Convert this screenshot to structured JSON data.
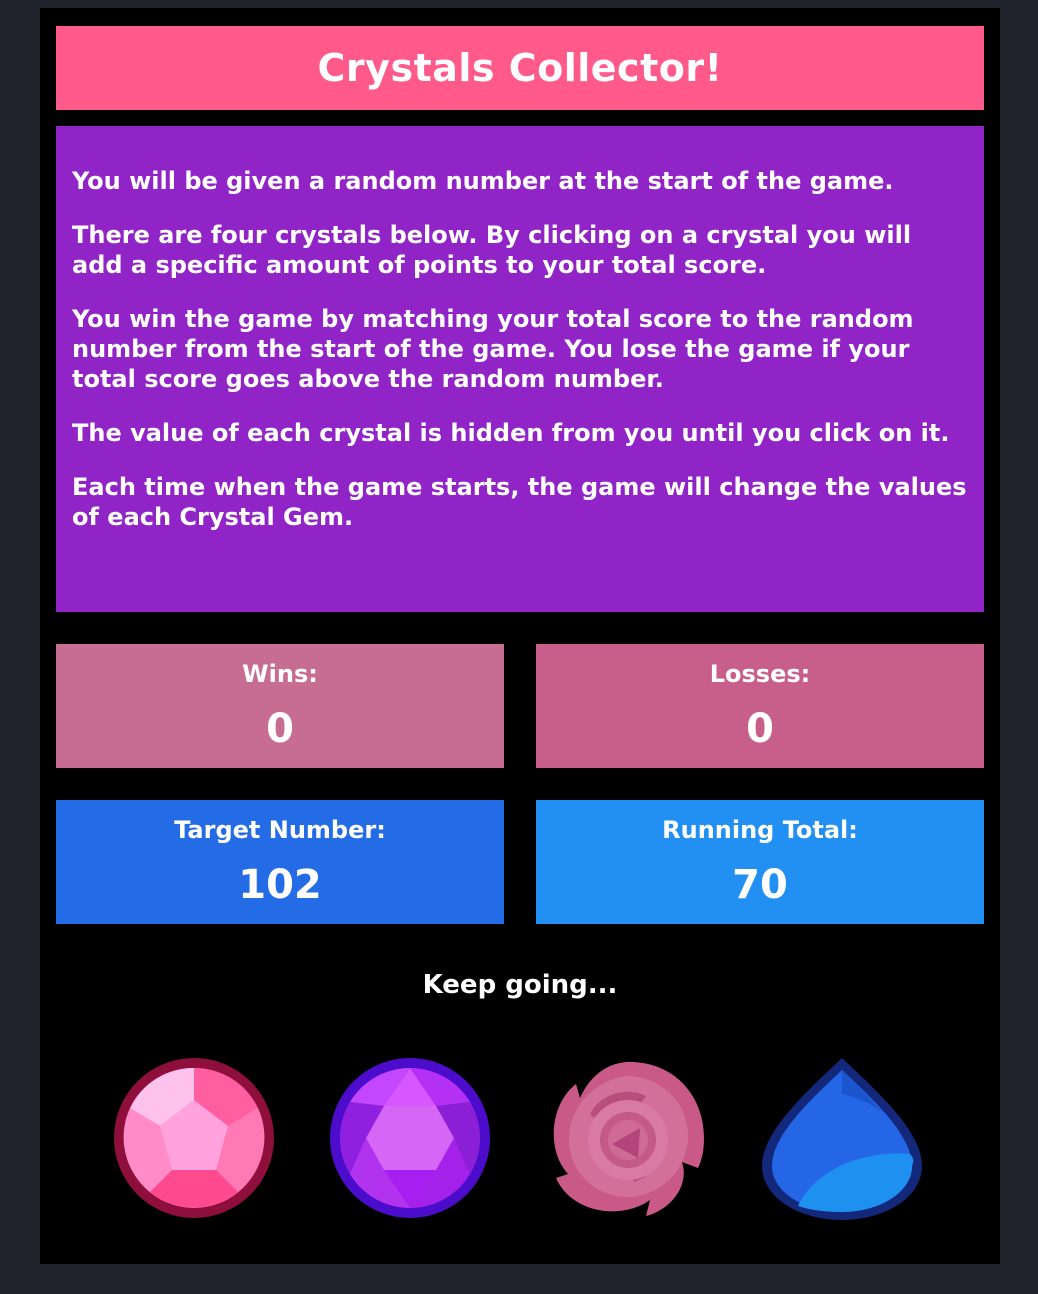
{
  "title": "Crystals Collector!",
  "instructions": [
    "You will be given a random number at the start of the game.",
    "There are four crystals below. By clicking on a crystal you will add a specific amount of points to your total score.",
    "You win the game by matching your total score to the random number from the start of the game. You lose the game if your total score goes above the random number.",
    "The value of each crystal is hidden from you until you click on it.",
    "Each time when the game starts, the game will change the values of each Crystal Gem."
  ],
  "stats": {
    "wins_label": "Wins:",
    "wins_value": "0",
    "losses_label": "Losses:",
    "losses_value": "0",
    "target_label": "Target Number:",
    "target_value": "102",
    "running_label": "Running Total:",
    "running_value": "70"
  },
  "status_message": "Keep going...",
  "crystals": [
    {
      "icon": "pink-pentagon-gem-icon",
      "color": "#ff6aa8"
    },
    {
      "icon": "purple-hexagon-gem-icon",
      "color": "#b23cf0"
    },
    {
      "icon": "rose-spiral-gem-icon",
      "color": "#cf6a92"
    },
    {
      "icon": "blue-teardrop-gem-icon",
      "color": "#2468e6"
    }
  ],
  "colors": {
    "background": "#21232d",
    "title_bar": "#ff5a8a",
    "instructions_bg": "#9124c6",
    "wins_bg": "#c76d91",
    "losses_bg": "#c75f8a",
    "target_bg": "#246ce6",
    "running_bg": "#2190f2"
  }
}
